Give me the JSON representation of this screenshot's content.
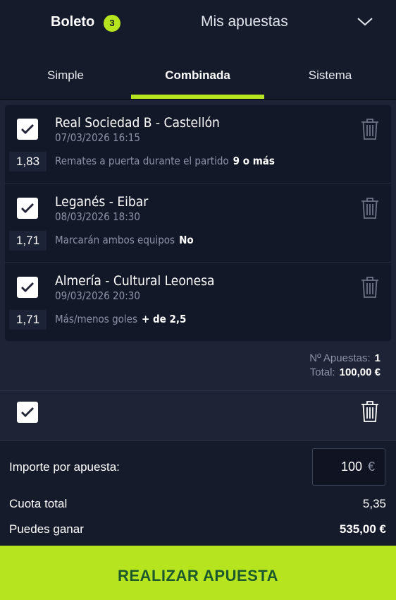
{
  "header": {
    "title": "Boleto",
    "badge_count": "3",
    "my_bets_label": "Mis apuestas"
  },
  "tabs": [
    {
      "label": "Simple",
      "active": false
    },
    {
      "label": "Combinada",
      "active": true
    },
    {
      "label": "Sistema",
      "active": false
    }
  ],
  "bets": [
    {
      "match": "Real Sociedad B - Castellón",
      "date": "07/03/2026 16:15",
      "odds": "1,83",
      "market": "Remates a puerta durante el partido",
      "selection": "9 o más",
      "checked": true
    },
    {
      "match": "Leganés - Eibar",
      "date": "08/03/2026 18:30",
      "odds": "1,71",
      "market": "Marcarán ambos equipos",
      "selection": "No",
      "checked": true
    },
    {
      "match": "Almería - Cultural Leonesa",
      "date": "09/03/2026 20:30",
      "odds": "1,71",
      "market": "Más/menos goles",
      "selection": "+ de 2,5",
      "checked": true
    }
  ],
  "summary": {
    "num_bets_label": "Nº Apuestas:",
    "num_bets_value": "1",
    "total_label": "Total:",
    "total_value": "100,00 €"
  },
  "stake": {
    "label": "Importe por apuesta:",
    "value": "100",
    "currency": "€"
  },
  "totals": {
    "odds_label": "Cuota total",
    "odds_value": "5,35",
    "win_label": "Puedes ganar",
    "win_value": "535,00 €"
  },
  "cta_label": "REALIZAR APUESTA",
  "colors": {
    "accent": "#b6e51f",
    "background": "#1e2436",
    "panel": "#131829",
    "cta_text": "#1c5a2e"
  }
}
